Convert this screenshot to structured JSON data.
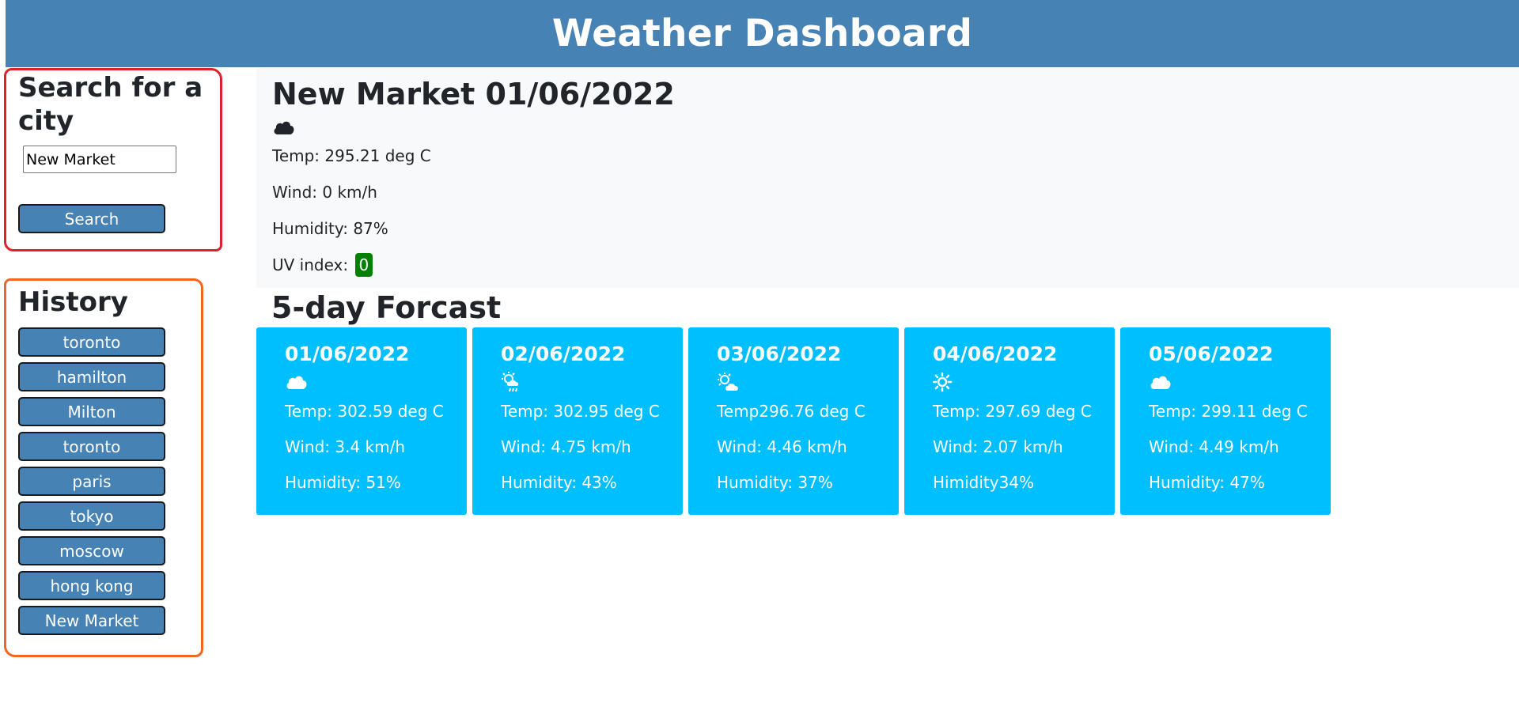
{
  "header": {
    "title": "Weather Dashboard"
  },
  "search": {
    "title": "Search for a city",
    "input_value": "New Market",
    "button_label": "Search"
  },
  "history": {
    "title": "History",
    "items": [
      "toronto",
      "hamilton",
      "Milton",
      "toronto",
      "paris",
      "tokyo",
      "moscow",
      "hong kong",
      "New Market"
    ]
  },
  "current": {
    "heading": "New Market 01/06/2022",
    "icon": "cloud-icon",
    "temp": "Temp: 295.21 deg C",
    "wind": "Wind: 0 km/h",
    "humidity": "Humidity: 87%",
    "uv_label": "UV index:",
    "uv_value": "0",
    "uv_color": "#008000"
  },
  "forecast": {
    "title": "5-day Forcast",
    "card_color": "#00bfff",
    "days": [
      {
        "date": "01/06/2022",
        "icon": "cloud-icon",
        "temp": "Temp: 302.59 deg C",
        "wind": "Wind: 3.4 km/h",
        "humidity": "Humidity: 51%"
      },
      {
        "date": "02/06/2022",
        "icon": "sun-rain-icon",
        "temp": "Temp: 302.95 deg C",
        "wind": "Wind: 4.75 km/h",
        "humidity": "Humidity: 43%"
      },
      {
        "date": "03/06/2022",
        "icon": "sun-cloud-icon",
        "temp": "Temp296.76 deg C",
        "wind": "Wind: 4.46 km/h",
        "humidity": "Humidity: 37%"
      },
      {
        "date": "04/06/2022",
        "icon": "sun-icon",
        "temp": "Temp: 297.69 deg C",
        "wind": "Wind: 2.07 km/h",
        "humidity": "Himidity34%"
      },
      {
        "date": "05/06/2022",
        "icon": "cloud-icon",
        "temp": "Temp: 299.11 deg C",
        "wind": "Wind: 4.49 km/h",
        "humidity": "Humidity: 47%"
      }
    ]
  },
  "colors": {
    "header": "#4682b4",
    "button": "#4682b4",
    "outline_search": "#e0202a",
    "outline_history": "#f26522"
  }
}
